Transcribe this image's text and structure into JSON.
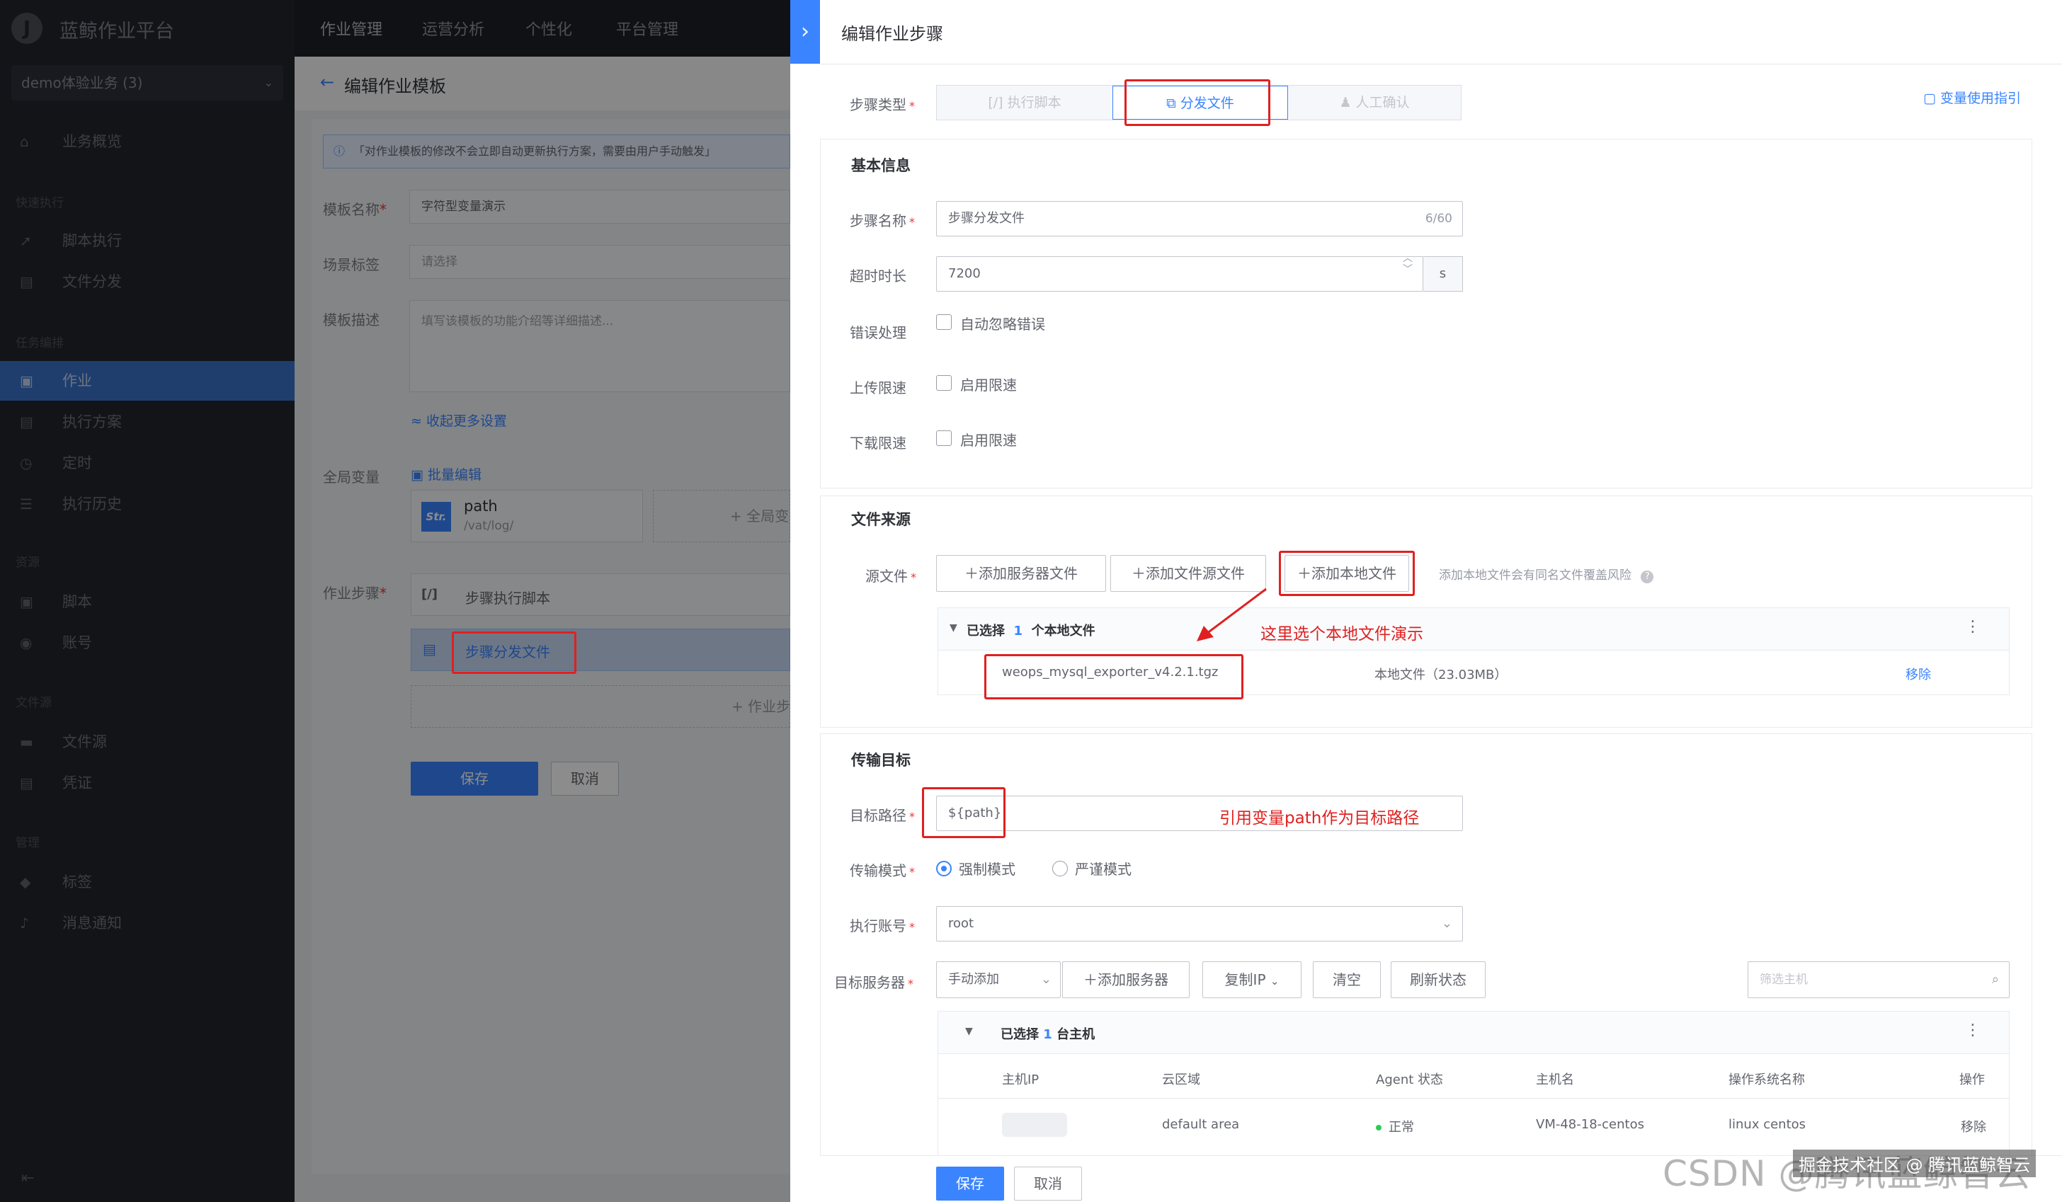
{
  "app": {
    "title": "蓝鲸作业平台",
    "logo_letter": "J"
  },
  "business": {
    "selected": "demo体验业务 (3)"
  },
  "top_menu": [
    "作业管理",
    "运营分析",
    "个性化",
    "平台管理"
  ],
  "nav": {
    "overview": "业务概览",
    "group_quick": "快速执行",
    "script_exec": "脚本执行",
    "file_dist": "文件分发",
    "group_task": "任务编排",
    "job": "作业",
    "exec_plan": "执行方案",
    "cron": "定时",
    "history": "执行历史",
    "group_resource": "资源",
    "script": "脚本",
    "account": "账号",
    "group_filesource": "文件源",
    "file_source": "文件源",
    "ticket": "凭证",
    "group_manage": "管理",
    "tag": "标签",
    "notify": "消息通知"
  },
  "middle": {
    "back_title": "编辑作业模板",
    "notice": "「对作业模板的修改不会立即自动更新执行方案，需要由用户手动触发」",
    "name_label": "模板名称",
    "name_value": "字符型变量演示",
    "tag_label": "场景标签",
    "tag_placeholder": "请选择",
    "desc_label": "模板描述",
    "desc_placeholder": "填写该模板的功能介绍等详细描述...",
    "collapse": "收起更多设置",
    "global_var_label": "全局变量",
    "batch_edit": "批量编辑",
    "var_type": "Str.",
    "var_name": "path",
    "var_value": "/vat/log/",
    "add_global": "全局变",
    "steps_label": "作业步骤",
    "step1_icon": "[/]",
    "step1": "步骤执行脚本",
    "step2": "步骤分发文件",
    "add_step": "作业步",
    "save": "保存",
    "cancel": "取消"
  },
  "panel": {
    "title": "编辑作业步骤",
    "step_type_label": "步骤类型",
    "step_types": [
      "执行脚本",
      "分发文件",
      "人工确认"
    ],
    "var_guide": "变量使用指引",
    "basic_title": "基本信息",
    "step_name_label": "步骤名称",
    "step_name_value": "步骤分发文件",
    "step_name_count": "6/60",
    "timeout_label": "超时时长",
    "timeout_value": "7200",
    "timeout_unit": "s",
    "error_label": "错误处理",
    "error_opt": "自动忽略错误",
    "upload_label": "上传限速",
    "upload_opt": "启用限速",
    "download_label": "下载限速",
    "download_opt": "启用限速",
    "source_title": "文件来源",
    "source_label": "源文件",
    "add_server_file": "添加服务器文件",
    "add_source_file": "添加文件源文件",
    "add_local_file": "添加本地文件",
    "local_hint": "添加本地文件会有同名文件覆盖风险",
    "selected_prefix": "已选择",
    "selected_count": "1",
    "selected_suffix": "个本地文件",
    "file_name": "weops_mysql_exporter_v4.2.1.tgz",
    "file_info": "本地文件（23.03MB）",
    "remove": "移除",
    "annotation1": "这里选个本地文件演示",
    "target_title": "传输目标",
    "target_path_label": "目标路径",
    "target_path_value": "${path}",
    "annotation2": "引用变量path作为目标路径",
    "mode_label": "传输模式",
    "mode_force": "强制模式",
    "mode_strict": "严谨模式",
    "account_label": "执行账号",
    "account_value": "root",
    "servers_label": "目标服务器",
    "manual_add": "手动添加",
    "add_server": "添加服务器",
    "copy_ip": "复制IP",
    "clear": "清空",
    "refresh": "刷新状态",
    "filter_placeholder": "筛选主机",
    "host_selected_prefix": "已选择",
    "host_selected_count": "1",
    "host_selected_suffix": "台主机",
    "columns": [
      "主机IP",
      "云区域",
      "Agent 状态",
      "主机名",
      "操作系统名称",
      "操作"
    ],
    "host_row": {
      "cloud": "default area",
      "status": "正常",
      "hostname": "VM-48-18-centos",
      "os": "linux centos",
      "action": "移除"
    },
    "save": "保存",
    "cancel": "取消"
  },
  "watermark": "CSDN @腾讯蓝鲸智云",
  "watermark2": "掘金技术社区 @ 腾讯蓝鲸智云",
  "colors": {
    "primary": "#3a84ff",
    "annotation": "#e02020",
    "sidebar": "#22252b",
    "success": "#2dcb56"
  }
}
